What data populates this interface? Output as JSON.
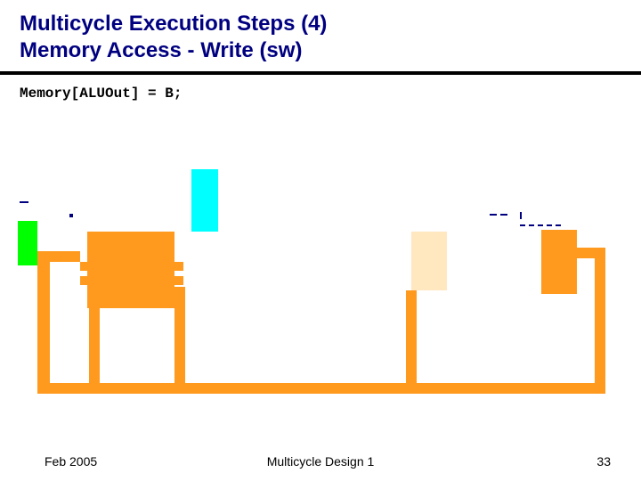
{
  "title": {
    "line1": "Multicycle Execution Steps (4)",
    "line2": "Memory Access - Write (sw)"
  },
  "code": "Memory[ALUOut] = B;",
  "diagram": {
    "colors": {
      "orange": "#ff9a1f",
      "cyan": "#00ffff",
      "green": "#00ff00",
      "pale": "#ffe7c0",
      "navy": "#000080"
    }
  },
  "footer": {
    "left": "Feb 2005",
    "center": "Multicycle Design 1",
    "right": "33"
  }
}
